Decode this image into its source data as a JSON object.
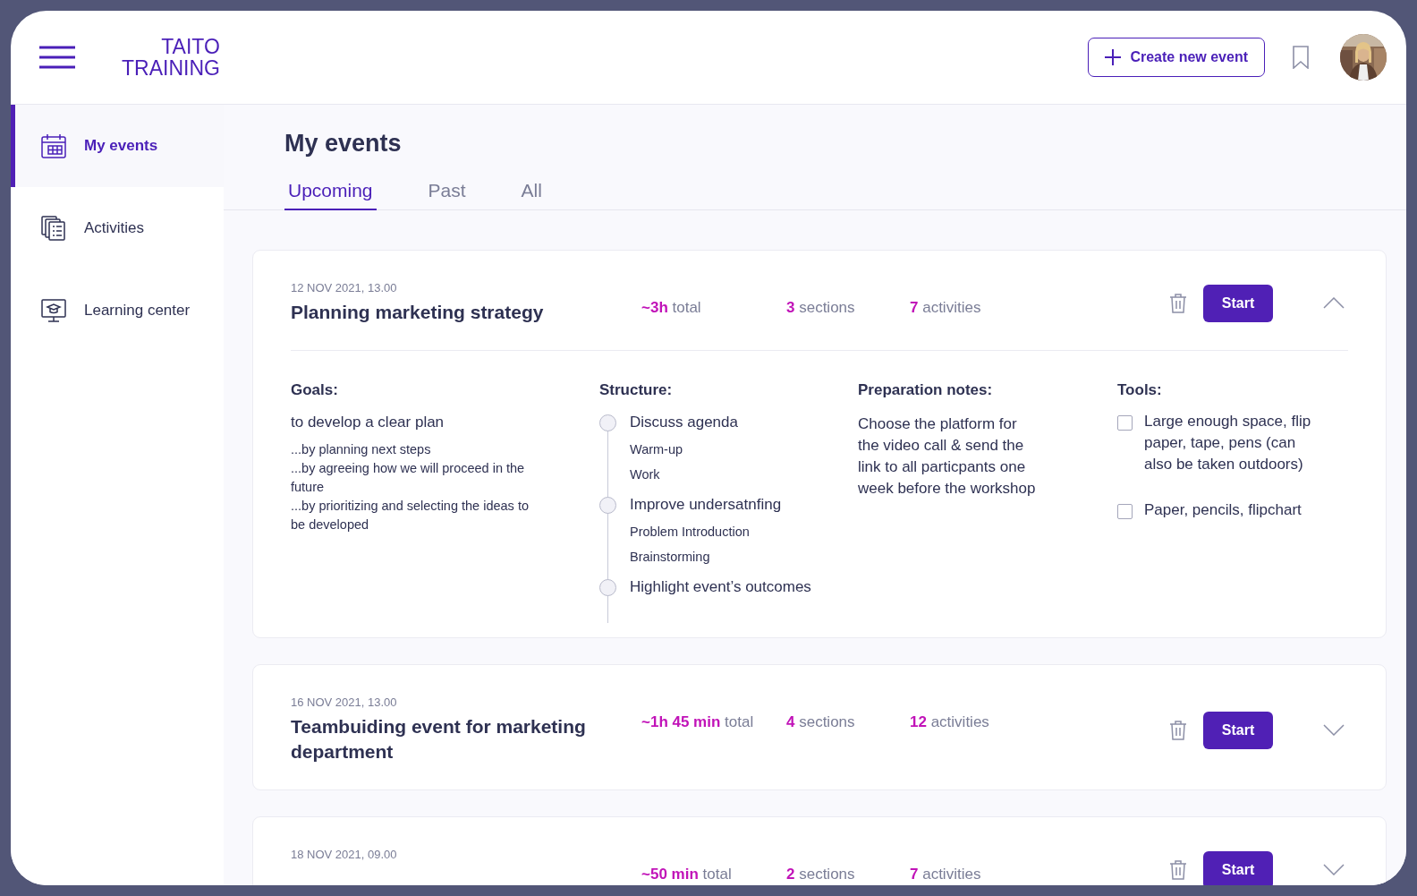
{
  "header": {
    "logo": [
      "TAITO",
      "TRAINING"
    ],
    "create_button": "Create new event"
  },
  "sidebar": {
    "items": [
      {
        "label": "My events",
        "selected": true
      },
      {
        "label": "Activities",
        "selected": false
      },
      {
        "label": "Learning center",
        "selected": false
      }
    ]
  },
  "page": {
    "title": "My events",
    "tabs": [
      {
        "label": "Upcoming",
        "selected": true
      },
      {
        "label": "Past",
        "selected": false
      },
      {
        "label": "All",
        "selected": false
      }
    ]
  },
  "events": [
    {
      "date": "12 NOV 2021, 13.00",
      "title": "Planning marketing strategy",
      "duration": {
        "value": "~3h",
        "unit": "total"
      },
      "sections": {
        "value": "3",
        "unit": "sections"
      },
      "activities": {
        "value": "7",
        "unit": "activities"
      },
      "start_label": "Start",
      "expanded": true,
      "details": {
        "goals": {
          "heading": "Goals:",
          "lead": "to develop a clear plan",
          "points": [
            "...by planning next steps",
            "...by agreeing how we will proceed in the future",
            "...by prioritizing and selecting the ideas to be developed"
          ]
        },
        "structure": {
          "heading": "Structure:",
          "sections": [
            {
              "title": "Discuss agenda",
              "children": [
                {
                  "title": "Warm-up"
                },
                {
                  "title": "Work"
                }
              ]
            },
            {
              "title": "Improve undersatnfing",
              "children": [
                {
                  "title": "Problem Introduction"
                },
                {
                  "title": "Brainstorming"
                }
              ]
            },
            {
              "title": "Highlight event’s outcomes"
            }
          ]
        },
        "notes": {
          "heading": "Preparation notes:",
          "text": "Choose the platform for the video call & send the link to all particpants one week before the workshop"
        },
        "tools": {
          "heading": "Tools:",
          "items": [
            {
              "label": "Large enough space, flip paper, tape, pens (can also be taken outdoors)",
              "checked": false
            },
            {
              "label": "Paper, pencils, flipchart",
              "checked": false
            }
          ]
        }
      }
    },
    {
      "date": "16 NOV 2021, 13.00",
      "title": "Teambuiding event for marketing department",
      "duration": {
        "value": "~1h 45 min",
        "unit": "total"
      },
      "sections": {
        "value": "4",
        "unit": "sections"
      },
      "activities": {
        "value": "12",
        "unit": "activities"
      },
      "start_label": "Start",
      "expanded": false
    },
    {
      "date": "18 NOV 2021, 09.00",
      "duration": {
        "value": "~50 min",
        "unit": "total"
      },
      "sections": {
        "value": "2",
        "unit": "sections"
      },
      "activities": {
        "value": "7",
        "unit": "activities"
      },
      "start_label": "Start",
      "expanded": false
    }
  ]
}
